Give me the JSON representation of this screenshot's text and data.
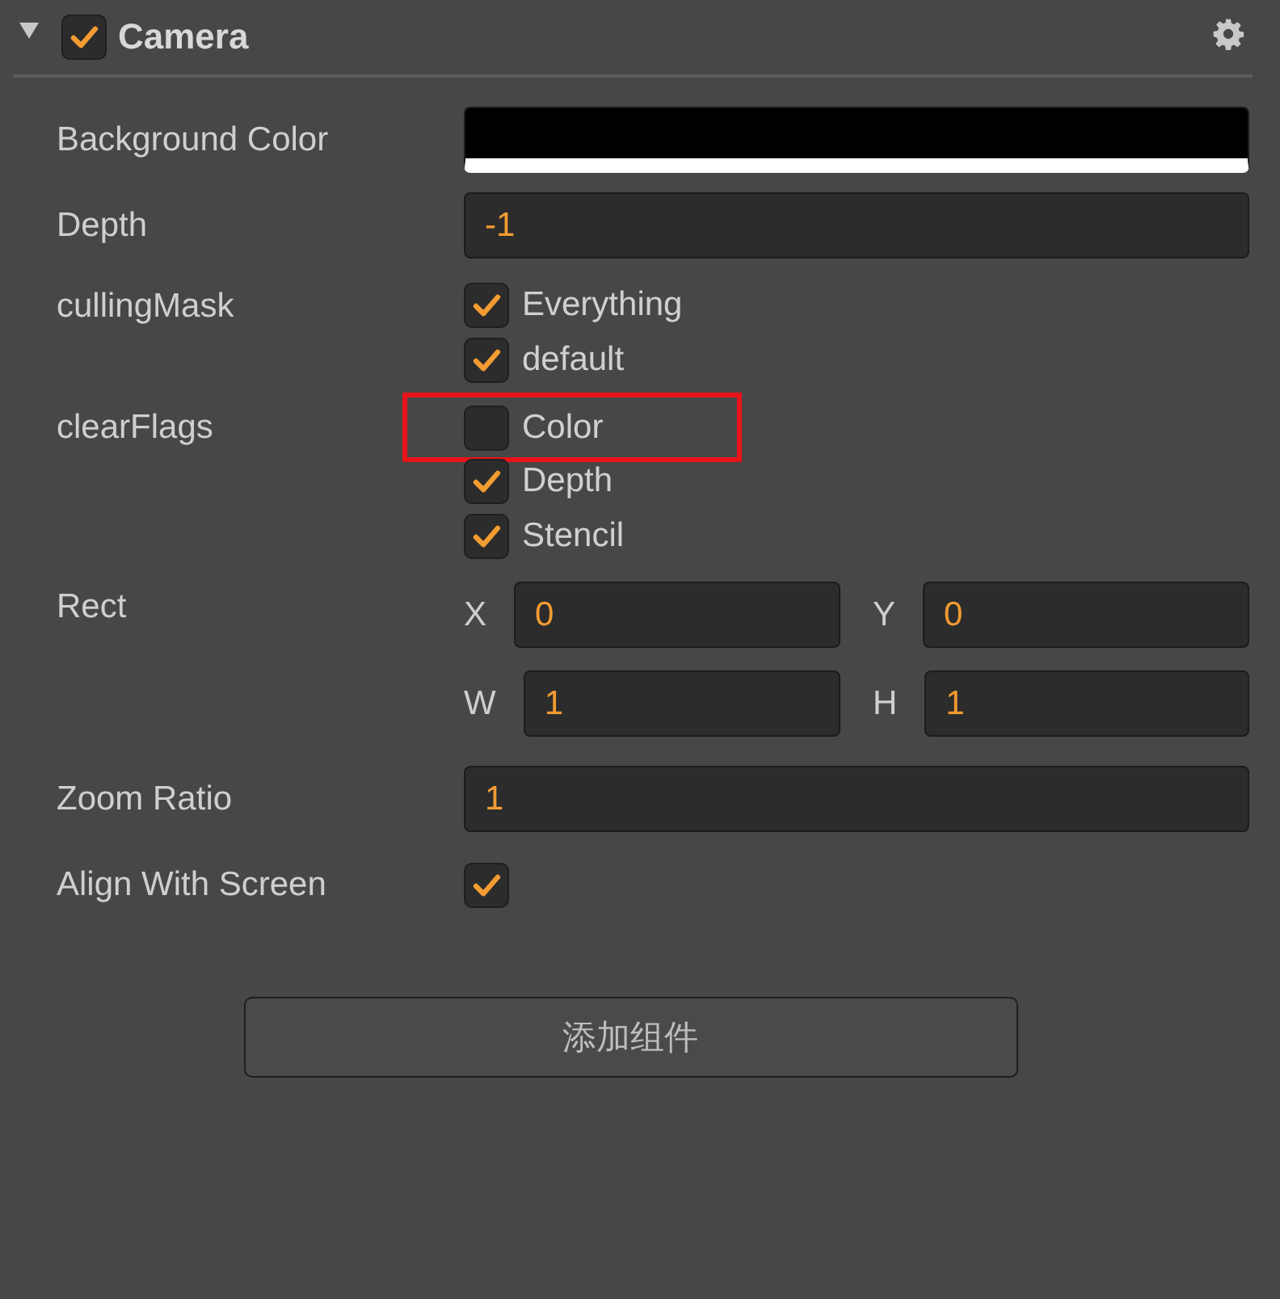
{
  "component": {
    "title": "Camera",
    "expanded": true,
    "enabled": true
  },
  "properties": [
    {
      "kind": "color",
      "label": "Background Color",
      "color": "#000000"
    },
    {
      "kind": "number",
      "label": "Depth",
      "value": "-1"
    },
    {
      "kind": "checklist",
      "label": "cullingMask",
      "options": [
        {
          "label": "Everything",
          "checked": true,
          "highlighted": false
        },
        {
          "label": "default",
          "checked": true,
          "highlighted": false
        }
      ]
    },
    {
      "kind": "checklist",
      "label": "clearFlags",
      "options": [
        {
          "label": "Color",
          "checked": false,
          "highlighted": true
        },
        {
          "label": "Depth",
          "checked": true,
          "highlighted": false
        },
        {
          "label": "Stencil",
          "checked": true,
          "highlighted": false
        }
      ]
    },
    {
      "kind": "rect",
      "label": "Rect",
      "fields": [
        {
          "label": "X",
          "value": "0"
        },
        {
          "label": "Y",
          "value": "0"
        },
        {
          "label": "W",
          "value": "1"
        },
        {
          "label": "H",
          "value": "1"
        }
      ]
    },
    {
      "kind": "number",
      "label": "Zoom Ratio",
      "value": "1"
    },
    {
      "kind": "toggle",
      "label": "Align With Screen",
      "checked": true
    }
  ],
  "add_button": "添加组件"
}
